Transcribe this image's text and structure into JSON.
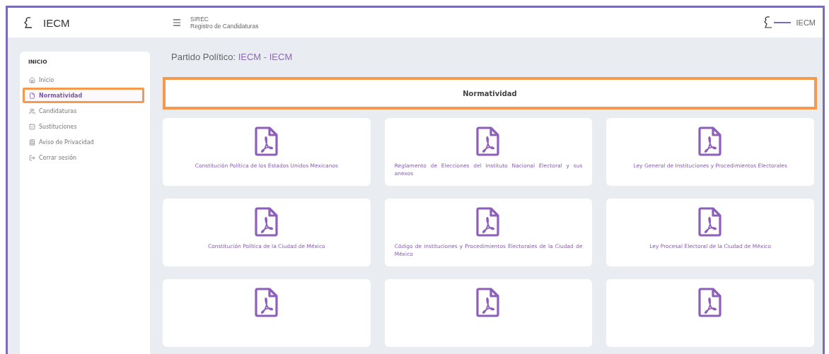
{
  "topbar": {
    "brand": "IECM",
    "system": "SIREC",
    "subtitle": "Registro de Candidaturas",
    "right_label": "IECM"
  },
  "sidebar": {
    "heading": "INICIO",
    "items": [
      {
        "label": "Inicio",
        "selected": false,
        "highlighted": false
      },
      {
        "label": "Normatividad",
        "selected": true,
        "highlighted": true
      },
      {
        "label": "Candidaturas",
        "selected": false,
        "highlighted": false
      },
      {
        "label": "Sustituciones",
        "selected": false,
        "highlighted": false
      },
      {
        "label": "Aviso de Privacidad",
        "selected": false,
        "highlighted": false
      },
      {
        "label": "Cerrar sesión",
        "selected": false,
        "highlighted": false
      }
    ]
  },
  "page": {
    "party_label": "Partido Político:",
    "party_value": "IECM - IECM",
    "section": {
      "title": "Normatividad",
      "highlighted": true
    }
  },
  "documents": [
    {
      "kind": "pdf",
      "title": "Constitución Política de los Estados Unidos Mexicanos"
    },
    {
      "kind": "pdf",
      "title": "Reglamento de Elecciones del Instituto Nacional Electoral y sus anexos"
    },
    {
      "kind": "pdf",
      "title": "Ley General de Instituciones y Procedimientos Electorales"
    },
    {
      "kind": "pdf",
      "title": "Constitución Política de la Ciudad de México"
    },
    {
      "kind": "pdf",
      "title": "Código de instituciones y Procedimientos Electorales de la Ciudad de México"
    },
    {
      "kind": "pdf",
      "title": "Ley Procesal Electoral de la Ciudad de México"
    },
    {
      "kind": "pdf"
    },
    {
      "kind": "pdf"
    },
    {
      "kind": "pdf"
    }
  ]
}
